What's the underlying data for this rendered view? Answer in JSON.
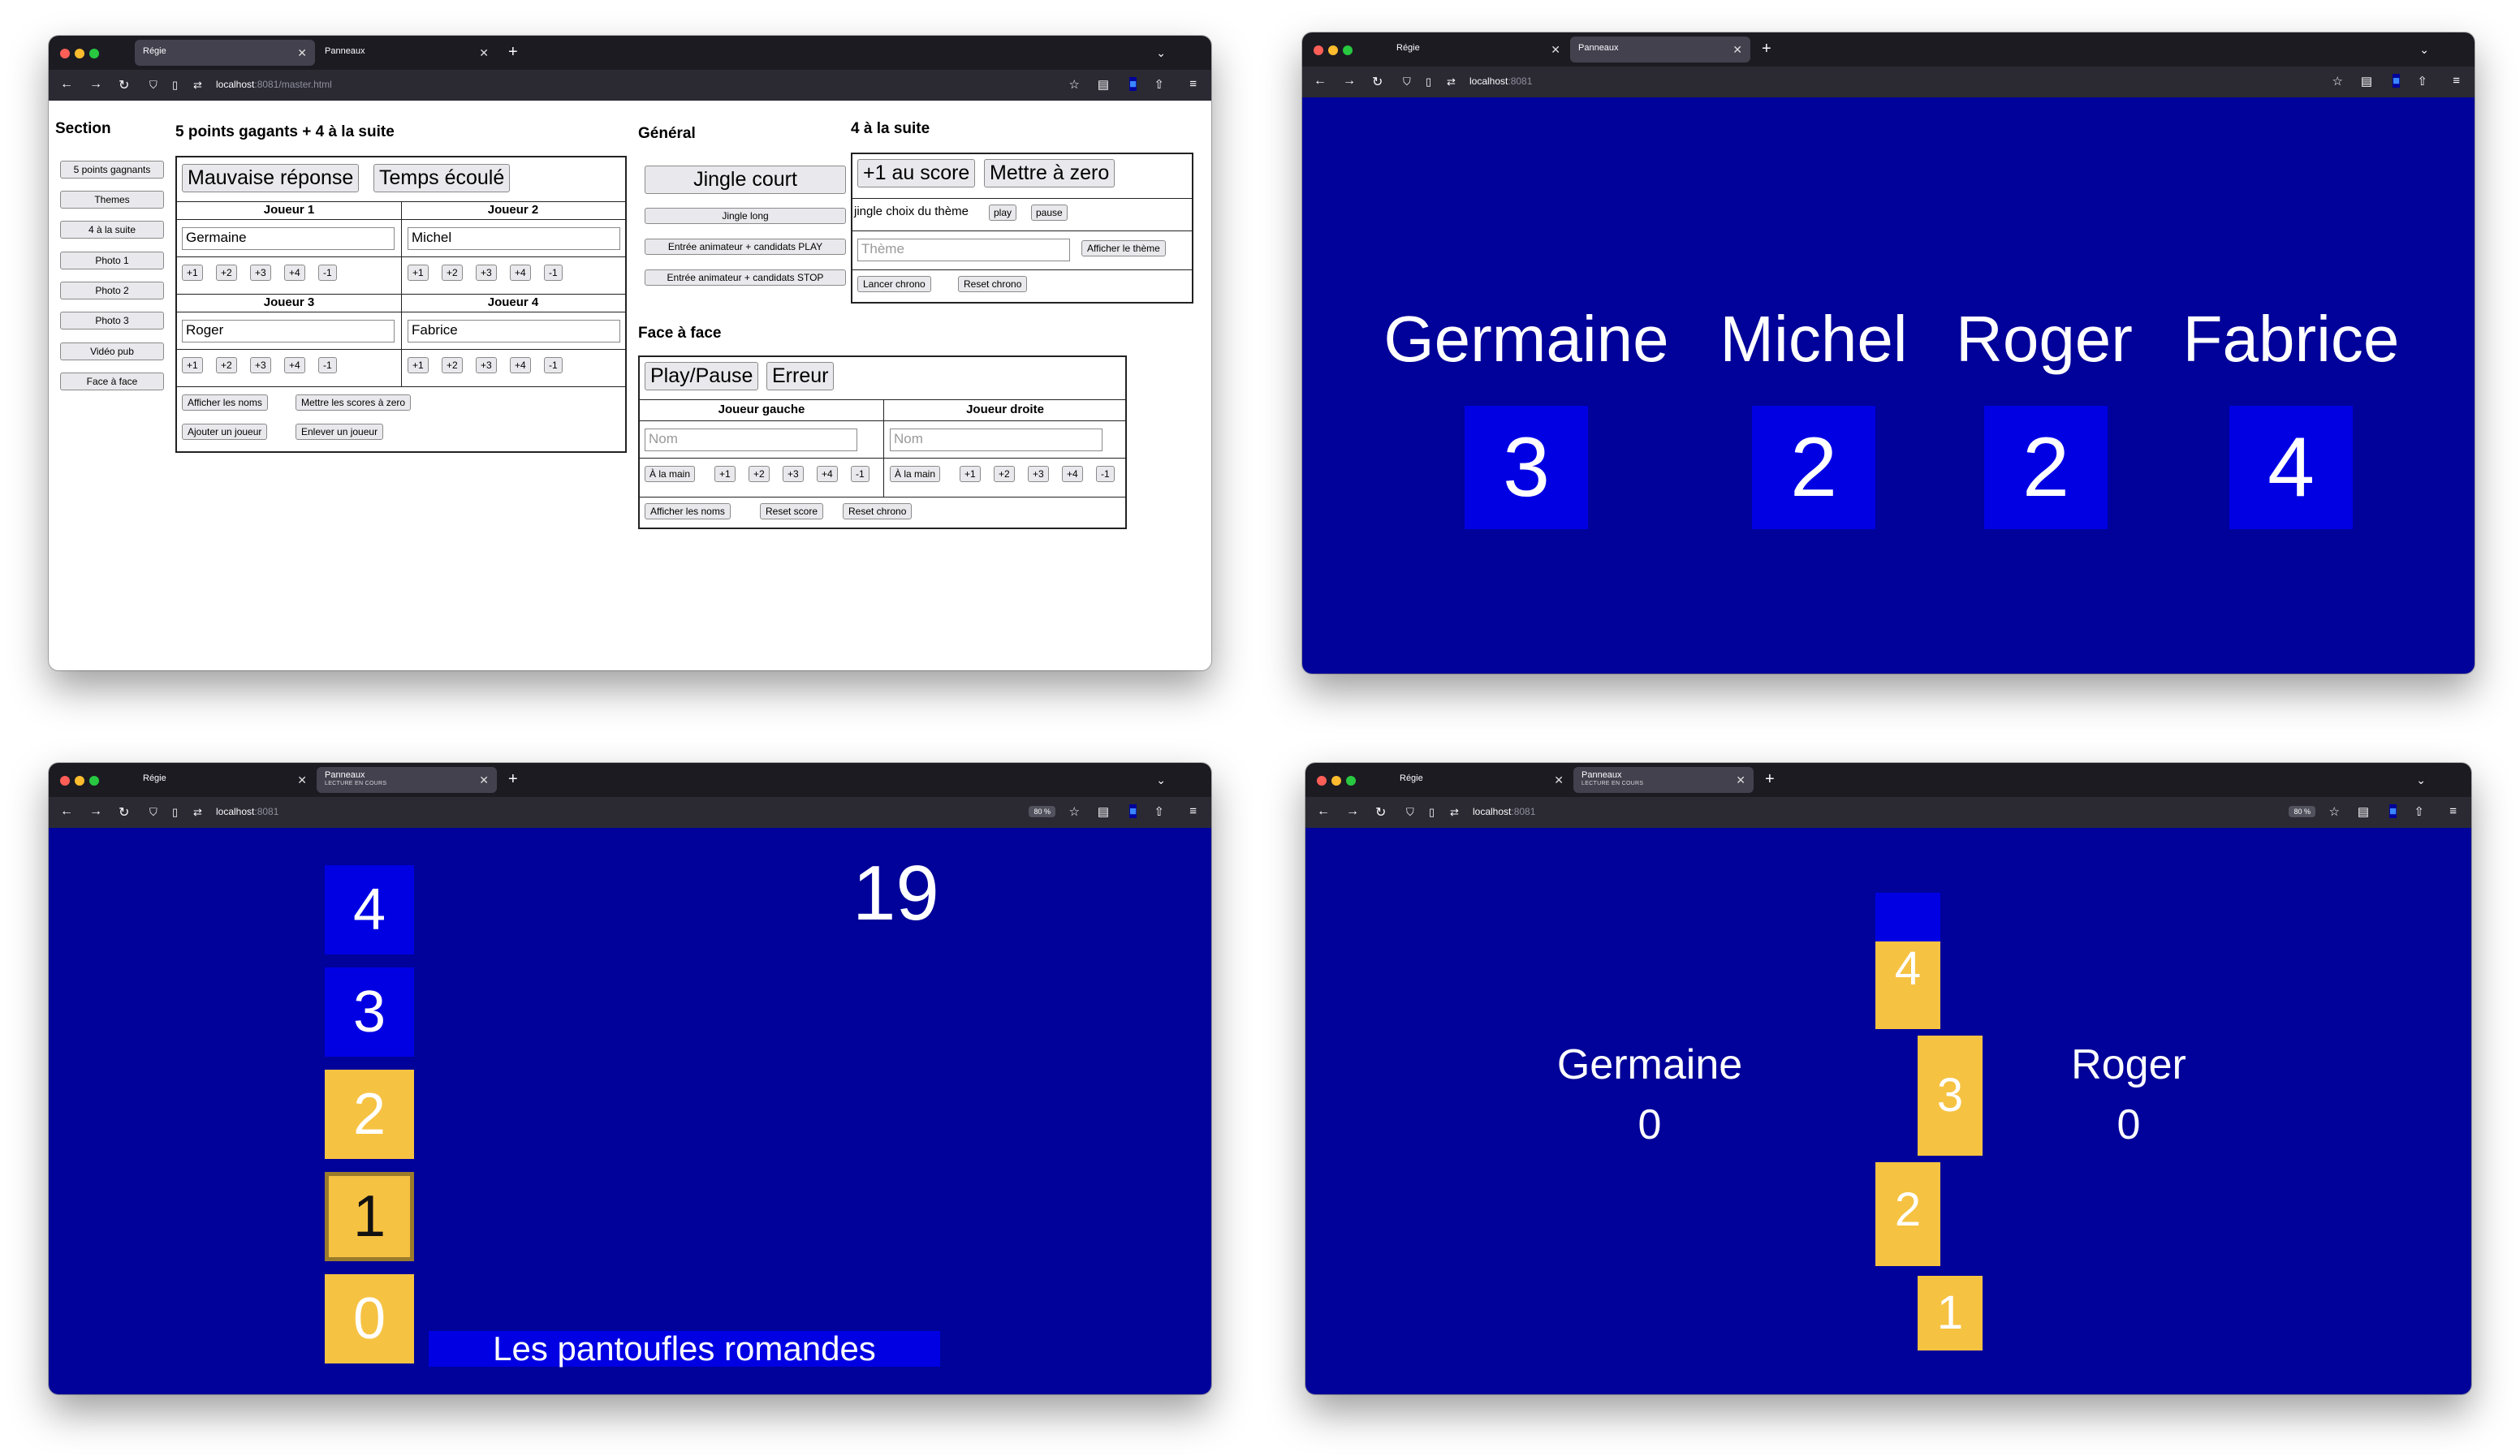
{
  "window_regie": {
    "tabs": [
      {
        "label": "Régie"
      },
      {
        "label": "Panneaux"
      }
    ],
    "url_host": "localhost",
    "url_rest": ":8081/master.html",
    "section_title": "Section",
    "sections": [
      "5 points gagnants",
      "Themes",
      "4 à la suite",
      "Photo 1",
      "Photo 2",
      "Photo 3",
      "Vidéo pub",
      "Face à face"
    ],
    "five_points": {
      "title": "5 points gagants + 4 à la suite",
      "wrong_answer": "Mauvaise réponse",
      "time_up": "Temps écoulé",
      "players": [
        {
          "label": "Joueur 1",
          "name": "Germaine"
        },
        {
          "label": "Joueur 2",
          "name": "Michel"
        },
        {
          "label": "Joueur 3",
          "name": "Roger"
        },
        {
          "label": "Joueur 4",
          "name": "Fabrice"
        }
      ],
      "score_buttons": [
        "+1",
        "+2",
        "+3",
        "+4",
        "-1"
      ],
      "show_names": "Afficher les noms",
      "reset_scores": "Mettre les scores à zero",
      "add_player": "Ajouter un joueur",
      "remove_player": "Enlever un joueur"
    },
    "general": {
      "title": "Général",
      "jingle_short": "Jingle court",
      "jingle_long": "Jingle long",
      "entry_play": "Entrée animateur + candidats PLAY",
      "entry_stop": "Entrée animateur + candidats STOP"
    },
    "four_row": {
      "title": "4 à la suite",
      "plus_one": "+1 au score",
      "reset_zero": "Mettre à zero",
      "jingle_label": "jingle choix du thème",
      "play": "play",
      "pause": "pause",
      "theme_placeholder": "Thème",
      "show_theme": "Afficher le thème",
      "start_timer": "Lancer chrono",
      "reset_timer": "Reset chrono"
    },
    "face_a_face": {
      "title": "Face à face",
      "play_pause": "Play/Pause",
      "error": "Erreur",
      "left_label": "Joueur gauche",
      "right_label": "Joueur droite",
      "name_placeholder": "Nom",
      "a_la_main": "À la main",
      "buttons": [
        "+1",
        "+2",
        "+3",
        "+4",
        "-1"
      ],
      "show_names": "Afficher les noms",
      "reset_score": "Reset score",
      "reset_timer": "Reset chrono"
    }
  },
  "window_panneaux_scores": {
    "tabs": [
      {
        "label": "Régie"
      },
      {
        "label": "Panneaux"
      }
    ],
    "url_host": "localhost",
    "url_rest": ":8081",
    "players": [
      {
        "name": "Germaine",
        "score": "3"
      },
      {
        "name": "Michel",
        "score": "2"
      },
      {
        "name": "Roger",
        "score": "2"
      },
      {
        "name": "Fabrice",
        "score": "4"
      }
    ]
  },
  "window_panneaux_ladder": {
    "tabs": [
      {
        "label": "Régie"
      },
      {
        "label": "Panneaux",
        "sub": "LECTURE EN COURS"
      }
    ],
    "url_host": "localhost",
    "url_rest": ":8081",
    "zoom": "80 %",
    "ladder": [
      "4",
      "3",
      "2",
      "1",
      "0"
    ],
    "timer": "19",
    "theme": "Les pantoufles romandes"
  },
  "window_panneaux_face": {
    "tabs": [
      {
        "label": "Régie"
      },
      {
        "label": "Panneaux",
        "sub": "LECTURE EN COURS"
      }
    ],
    "url_host": "localhost",
    "url_rest": ":8081",
    "zoom": "80 %",
    "left": {
      "name": "Germaine",
      "score": "0"
    },
    "right": {
      "name": "Roger",
      "score": "0"
    },
    "stack": [
      "4",
      "3",
      "2",
      "1"
    ]
  },
  "colors": {
    "panel_blue": "#000299",
    "tile_blue": "#0000e3",
    "tile_yellow": "#f6c242"
  }
}
